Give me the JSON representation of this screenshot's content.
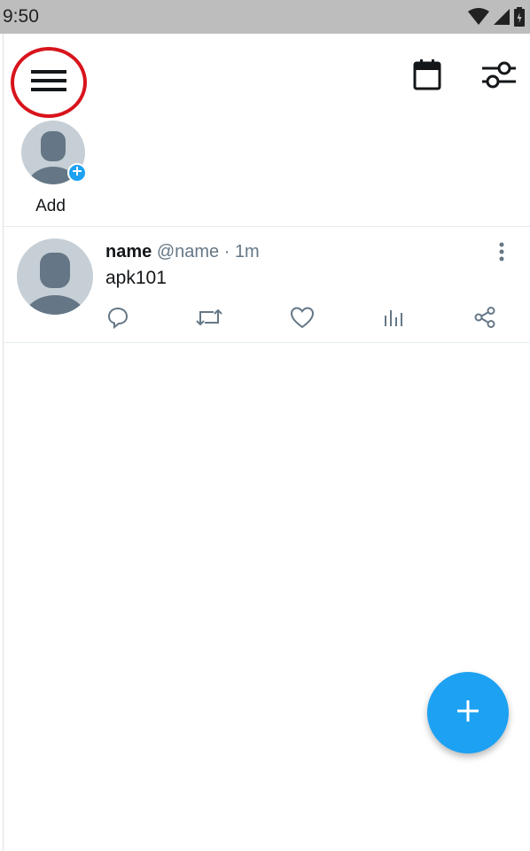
{
  "status_bar": {
    "time": "9:50",
    "icons": [
      "wifi-icon",
      "signal-icon",
      "battery-icon"
    ]
  },
  "toolbar": {
    "menu_icon": "hamburger-menu-icon",
    "calendar_icon": "calendar-icon",
    "filter_icon": "filter-sliders-icon"
  },
  "add_account": {
    "label": "Add",
    "badge_icon": "plus-icon"
  },
  "tweet": {
    "name": "name",
    "handle": "@name",
    "separator": " · ",
    "time": "1m",
    "text": "apk101",
    "actions": [
      "reply-icon",
      "retweet-icon",
      "like-icon",
      "analytics-icon",
      "share-icon"
    ],
    "more_icon": "more-vertical-icon"
  },
  "fab": {
    "icon": "plus-icon"
  },
  "colors": {
    "accent": "#1da1f2",
    "highlight_ring": "#d8141c",
    "status_bar": "#bdbdbd",
    "avatar_bg": "#c6cfd6",
    "avatar_fg": "#657786",
    "meta_text": "#657786"
  }
}
